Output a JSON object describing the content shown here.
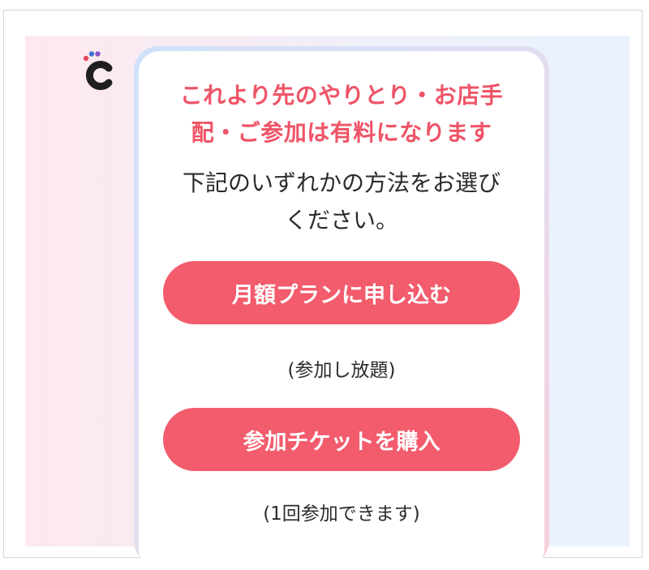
{
  "dialog": {
    "headline_line1": "これより先のやりとり・お店手",
    "headline_line2": "配・ご参加は有料になります",
    "instruction_line1": "下記のいずれかの方法をお選び",
    "instruction_line2": "ください。"
  },
  "options": {
    "monthly_button_label": "月額プランに申し込む",
    "monthly_note": "(参加し放題)",
    "ticket_button_label": "参加チケットを購入",
    "ticket_note": "(1回参加できます)"
  },
  "logo": {
    "icon": "app-logo-c-icon"
  },
  "colors": {
    "accent": "#f25c6d",
    "headline": "#ef5467",
    "text": "#2b2b2b",
    "logo_dark": "#1f1f1f",
    "logo_dot_red": "#e8485c",
    "logo_dot_blue": "#3d74d8",
    "logo_dot_purple": "#8a56c8"
  }
}
